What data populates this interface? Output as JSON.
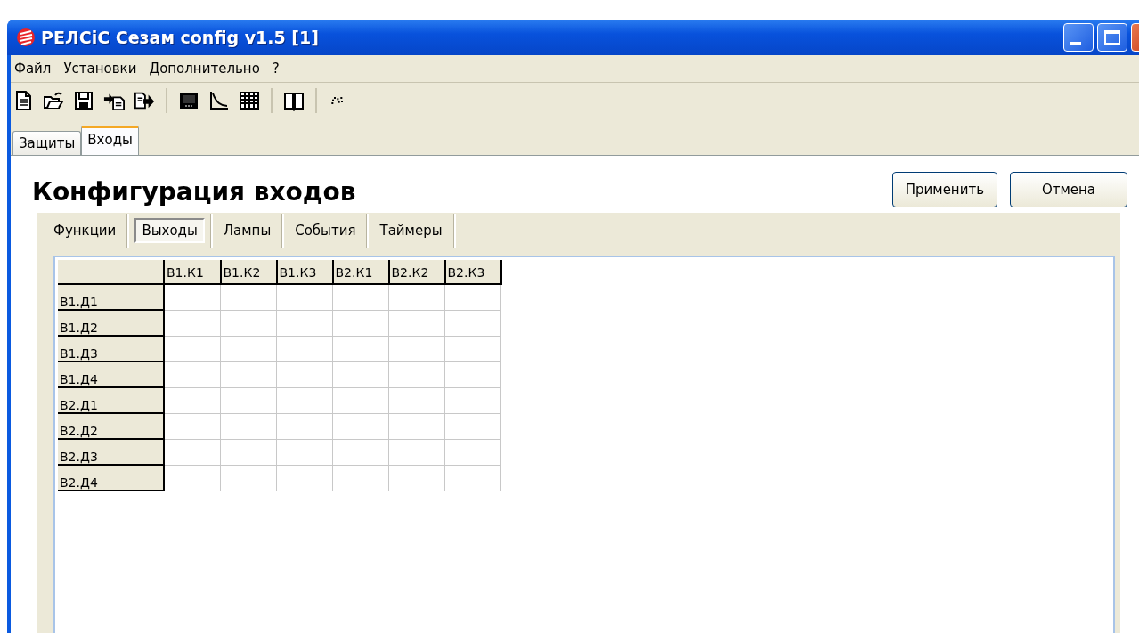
{
  "window": {
    "title": "РЕЛСiС Сезам config v1.5 [1]"
  },
  "menu": [
    "Файл",
    "Установки",
    "Дополнительно",
    "?"
  ],
  "tabs": [
    {
      "label": "Защиты",
      "selected": false
    },
    {
      "label": "Входы",
      "selected": true
    }
  ],
  "heading": "Конфигурация входов",
  "buttons": [
    "Применить",
    "Отмена"
  ],
  "subtabs": [
    {
      "label": "Функции",
      "selected": false
    },
    {
      "label": "Выходы",
      "selected": true
    },
    {
      "label": "Лампы",
      "selected": false
    },
    {
      "label": "События",
      "selected": false
    },
    {
      "label": "Таймеры",
      "selected": false
    }
  ],
  "grid": {
    "columns": [
      "В1.К1",
      "В1.К2",
      "В1.К3",
      "В2.К1",
      "В2.К2",
      "В2.К3"
    ],
    "rows": [
      "В1.Д1",
      "В1.Д2",
      "В1.Д3",
      "В1.Д4",
      "В2.Д1",
      "В2.Д2",
      "В2.Д3",
      "В2.Д4"
    ]
  }
}
